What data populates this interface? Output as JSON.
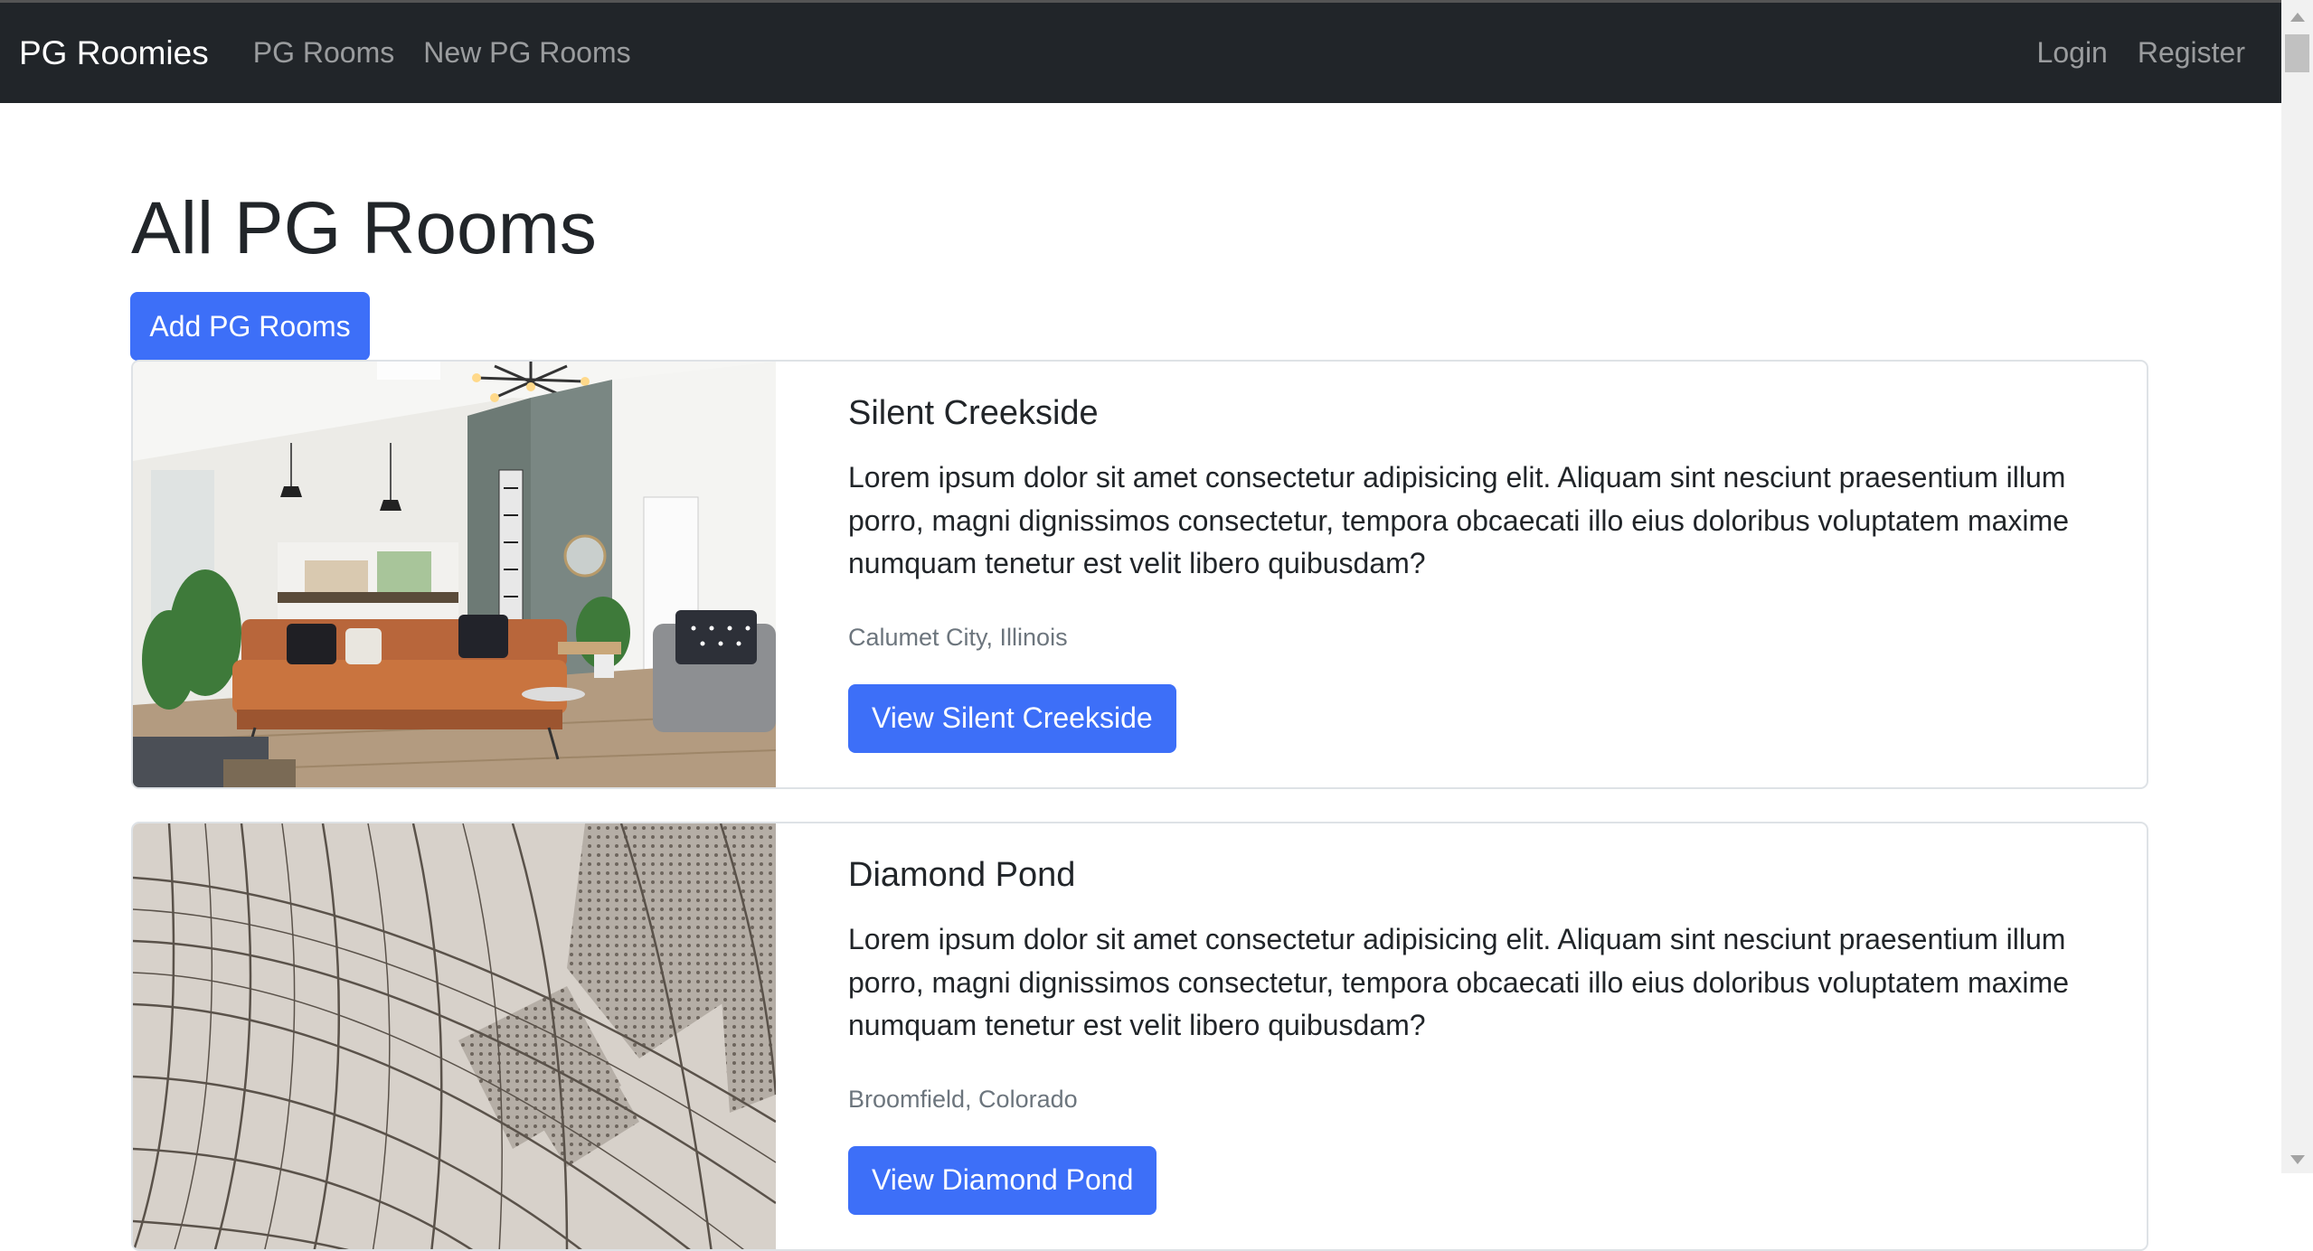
{
  "navbar": {
    "brand": "PG Roomies",
    "links": [
      "PG Rooms",
      "New PG Rooms"
    ],
    "right_links": [
      "Login",
      "Register"
    ],
    "background": "#212529"
  },
  "main": {
    "title": "All PG Rooms",
    "add_button": "Add PG Rooms",
    "accent": "#3d6ff8"
  },
  "rooms": [
    {
      "title": "Silent Creekside",
      "description": "Lorem ipsum dolor sit amet consectetur adipisicing elit. Aliquam sint nesciunt praesentium illum porro, magni dignissimos consectetur, tempora obcaecati illo eius doloribus voluptatem maxime numquam tenetur est velit libero quibusdam?",
      "location": "Calumet City, Illinois",
      "button": "View Silent Creekside",
      "image": "living-room-photo"
    },
    {
      "title": "Diamond Pond",
      "description": "Lorem ipsum dolor sit amet consectetur adipisicing elit. Aliquam sint nesciunt praesentium illum porro, magni dignissimos consectetur, tempora obcaecati illo eius doloribus voluptatem maxime numquam tenetur est velit libero quibusdam?",
      "location": "Broomfield, Colorado",
      "button": "View Diamond Pond",
      "image": "tiled-ceiling-photo"
    }
  ]
}
